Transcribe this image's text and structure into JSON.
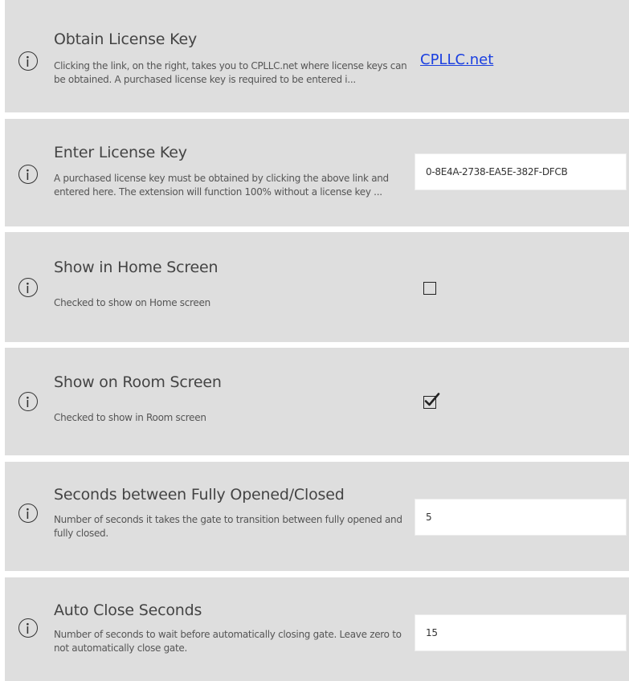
{
  "settings": {
    "obtain_license": {
      "title": "Obtain License Key",
      "description": "Clicking the link, on the right, takes you to CPLLC.net where license keys can be obtained.  A purchased license key is required to be entered i...",
      "link_label": "CPLLC.net"
    },
    "enter_license": {
      "title": "Enter License Key",
      "description": "A purchased license key must be obtained by clicking the above link and entered here. The extension will function 100% without a license key ...",
      "value": "0-8E4A-2738-EA5E-382F-DFCB"
    },
    "show_home": {
      "title": "Show in Home Screen",
      "description": "Checked to show on Home screen",
      "checked": false
    },
    "show_room": {
      "title": "Show on Room Screen",
      "description": "Checked to show in Room screen",
      "checked": true
    },
    "seconds_open_close": {
      "title": "Seconds between Fully Opened/Closed",
      "description": "Number of seconds it takes the gate to transition between fully opened and fully closed.",
      "value": "5"
    },
    "auto_close": {
      "title": "Auto Close Seconds",
      "description": "Number of seconds to wait before automatically closing gate.  Leave zero to not automatically close gate.",
      "value": "15"
    }
  },
  "colors": {
    "row_background": "#dedede",
    "link": "#1a3fe0"
  },
  "icons": {
    "info": "info-icon",
    "check": "checkmark-icon"
  }
}
